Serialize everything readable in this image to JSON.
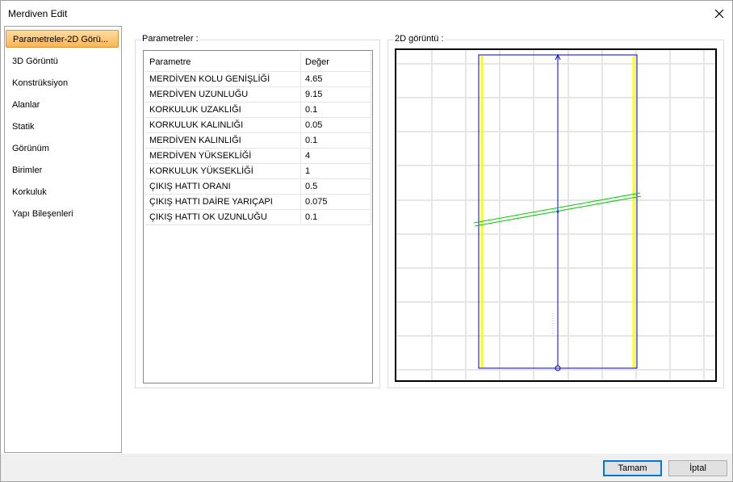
{
  "window": {
    "title": "Merdiven Edit"
  },
  "sidebar": {
    "items": [
      {
        "label": "Parametreler-2D Görü..."
      },
      {
        "label": "3D Görüntü"
      },
      {
        "label": "Konstrüksiyon"
      },
      {
        "label": "Alanlar"
      },
      {
        "label": "Statik"
      },
      {
        "label": "Görünüm"
      },
      {
        "label": "Birimler"
      },
      {
        "label": "Korkuluk"
      },
      {
        "label": "Yapı Bileşenleri"
      }
    ]
  },
  "params": {
    "group_label": "Parametreler :",
    "col_param": "Parametre",
    "col_value": "Değer",
    "rows": [
      {
        "name": "MERDİVEN KOLU GENİŞLİĞİ",
        "value": "4.65"
      },
      {
        "name": "MERDİVEN UZUNLUĞU",
        "value": "9.15"
      },
      {
        "name": "KORKULUK UZAKLIĞI",
        "value": "0.1"
      },
      {
        "name": "KORKULUK KALINLIĞI",
        "value": "0.05"
      },
      {
        "name": "MERDİVEN KALINLIĞI",
        "value": "0.1"
      },
      {
        "name": "MERDİVEN YÜKSEKLİĞİ",
        "value": "4"
      },
      {
        "name": "KORKULUK YÜKSEKLİĞİ",
        "value": "1"
      },
      {
        "name": "ÇIKIŞ HATTI ORANI",
        "value": "0.5"
      },
      {
        "name": "ÇIKIŞ HATTI DAİRE YARIÇAPI",
        "value": "0.075"
      },
      {
        "name": "ÇIKIŞ HATTI OK UZUNLUĞU",
        "value": "0.1"
      }
    ]
  },
  "view2d": {
    "group_label": "2D görüntü :"
  },
  "footer": {
    "ok_label": "Tamam",
    "cancel_label": "İptal"
  },
  "colors": {
    "selection": "#f9b65a",
    "stair_outline": "#0000cc",
    "railing": "#ffff00",
    "walk_line": "#00cc00",
    "grid": "#e6e6e6",
    "ok_border": "#0078d7"
  }
}
